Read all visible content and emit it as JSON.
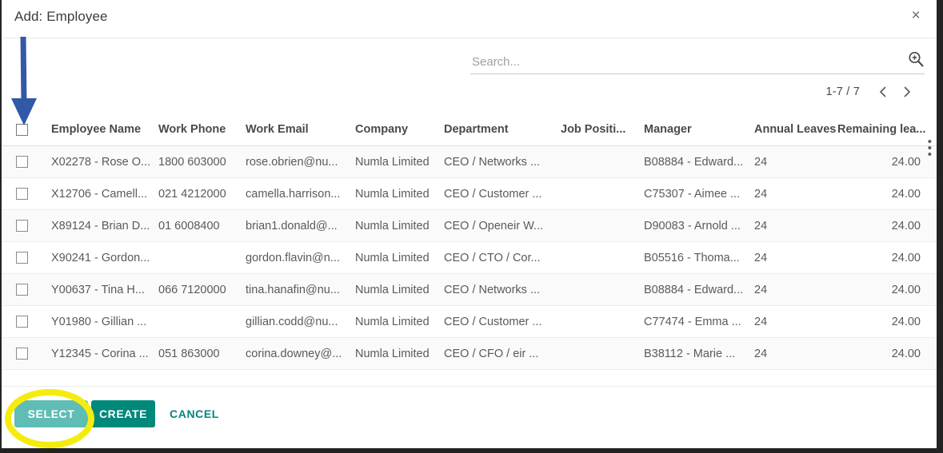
{
  "dialog": {
    "title": "Add: Employee",
    "close_label": "×"
  },
  "search": {
    "value": "",
    "placeholder": "Search...",
    "icon": "search-zoom-in-icon"
  },
  "pager": {
    "count": "1-7 / 7",
    "prev_label": "‹",
    "next_label": "›"
  },
  "table": {
    "optional_columns_icon": "vertical-dots-icon",
    "headers": [
      "Employee Name",
      "Work Phone",
      "Work Email",
      "Company",
      "Department",
      "Job Positi...",
      "Manager",
      "Annual Leaves",
      "Remaining lea..."
    ],
    "rows": [
      {
        "name": "X02278 - Rose O...",
        "phone": "1800 603000",
        "email": "rose.obrien@nu...",
        "company": "Numla Limited",
        "department": "CEO / Networks ...",
        "job_position": "",
        "manager": "B08884 - Edward...",
        "annual_leaves": "24",
        "remaining_leaves": "24.00"
      },
      {
        "name": "X12706 - Camell...",
        "phone": "021 4212000",
        "email": "camella.harrison...",
        "company": "Numla Limited",
        "department": "CEO / Customer ...",
        "job_position": "",
        "manager": "C75307 - Aimee ...",
        "annual_leaves": "24",
        "remaining_leaves": "24.00"
      },
      {
        "name": "X89124 - Brian D...",
        "phone": "01 6008400",
        "email": "brian1.donald@...",
        "company": "Numla Limited",
        "department": "CEO / Openeir W...",
        "job_position": "",
        "manager": "D90083 - Arnold ...",
        "annual_leaves": "24",
        "remaining_leaves": "24.00"
      },
      {
        "name": "X90241 - Gordon...",
        "phone": "",
        "email": "gordon.flavin@n...",
        "company": "Numla Limited",
        "department": "CEO / CTO / Cor...",
        "job_position": "",
        "manager": "B05516 - Thoma...",
        "annual_leaves": "24",
        "remaining_leaves": "24.00"
      },
      {
        "name": "Y00637 - Tina H...",
        "phone": "066 7120000",
        "email": "tina.hanafin@nu...",
        "company": "Numla Limited",
        "department": "CEO / Networks ...",
        "job_position": "",
        "manager": "B08884 - Edward...",
        "annual_leaves": "24",
        "remaining_leaves": "24.00"
      },
      {
        "name": "Y01980 - Gillian ...",
        "phone": "",
        "email": "gillian.codd@nu...",
        "company": "Numla Limited",
        "department": "CEO / Customer ...",
        "job_position": "",
        "manager": "C77474 - Emma ...",
        "annual_leaves": "24",
        "remaining_leaves": "24.00"
      },
      {
        "name": "Y12345 - Corina ...",
        "phone": "051 863000",
        "email": "corina.downey@...",
        "company": "Numla Limited",
        "department": "CEO / CFO / eir ...",
        "job_position": "",
        "manager": "B38112 - Marie ...",
        "annual_leaves": "24",
        "remaining_leaves": "24.00"
      }
    ]
  },
  "footer": {
    "select_label": "SELECT",
    "create_label": "CREATE",
    "cancel_label": "CANCEL"
  },
  "annotations": {
    "arrow_color": "#3259a5",
    "highlight_color": "#f5ec0f",
    "arrow_target": "select-all-checkbox",
    "highlight_target": "select-button"
  }
}
